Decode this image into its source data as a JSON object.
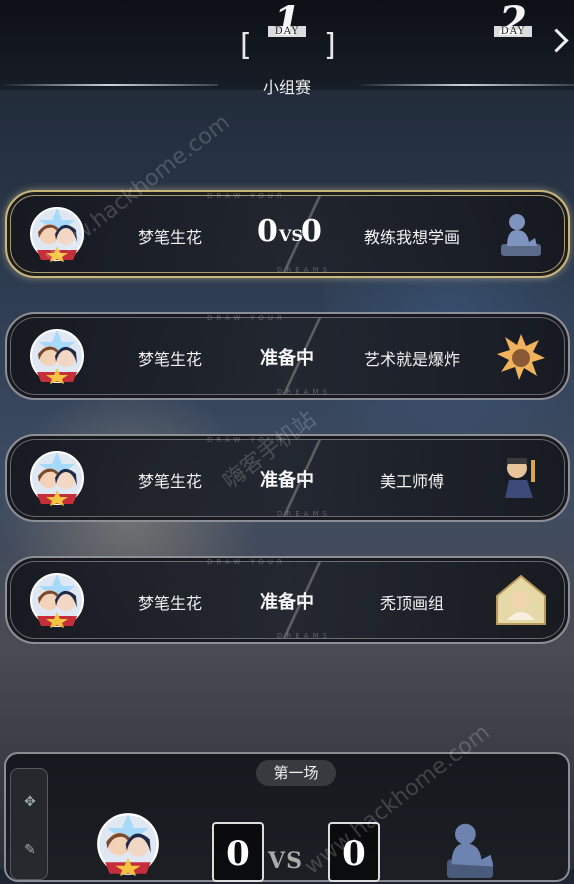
{
  "header": {
    "current_day": {
      "num": "1",
      "word": "DAY"
    },
    "next_day": {
      "num": "2",
      "word": "DAY"
    },
    "stage_title": "小组赛",
    "left_bracket": "[",
    "right_bracket": "]"
  },
  "matches": [
    {
      "left_team": "梦笔生花",
      "right_team": "教练我想学画",
      "left_score": "0",
      "right_score": "0",
      "vs": "VS",
      "status": "",
      "active": true
    },
    {
      "left_team": "梦笔生花",
      "right_team": "艺术就是爆炸",
      "status": "准备中",
      "active": false
    },
    {
      "left_team": "梦笔生花",
      "right_team": "美工师傅",
      "status": "准备中",
      "active": false
    },
    {
      "left_team": "梦笔生花",
      "right_team": "秃顶画组",
      "status": "准备中",
      "active": false
    }
  ],
  "card_deco": {
    "top": "DRAW YOUR",
    "bottom": "DREAMS"
  },
  "bottom_panel": {
    "round_label": "第一场",
    "left_score": "0",
    "right_score": "0",
    "vs": "VS"
  },
  "watermarks": [
    "www.hackhome.com",
    "嗨客手机站",
    "www.hackhome.com"
  ],
  "colors": {
    "active_border": "#c9b67a",
    "card_border": "#8c8f96"
  }
}
